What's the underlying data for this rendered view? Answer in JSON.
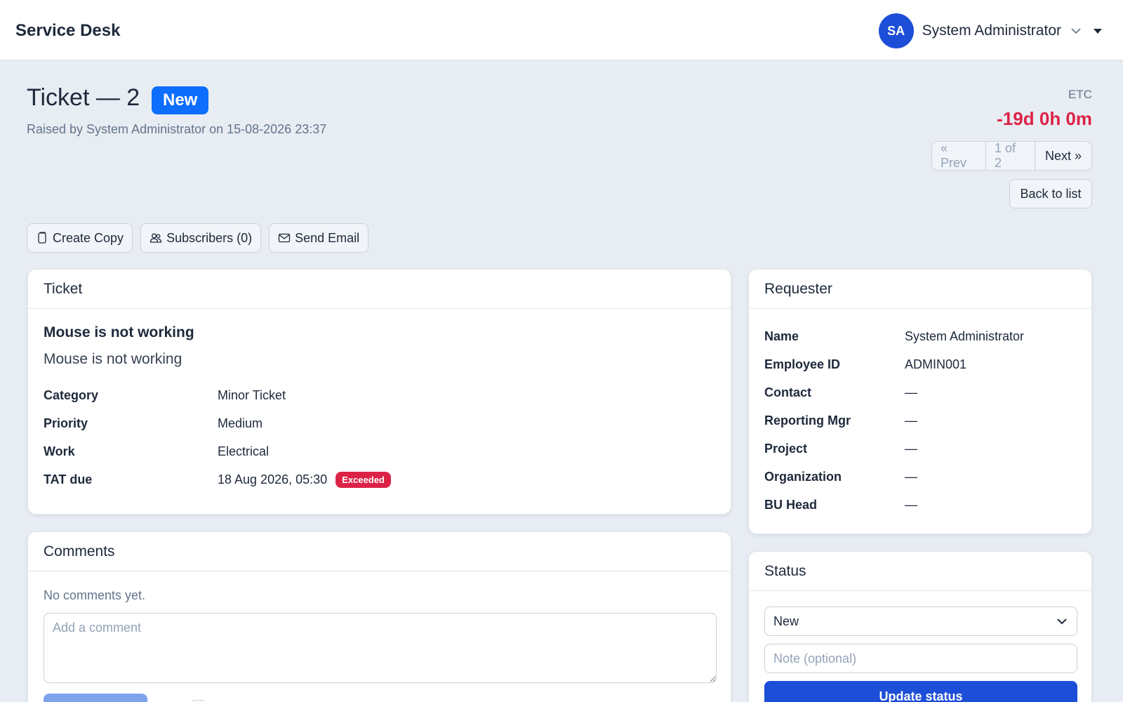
{
  "app": {
    "brand": "Service Desk"
  },
  "user": {
    "initials": "SA",
    "name": "System Administrator"
  },
  "ticket_header": {
    "title": "Ticket — 2",
    "status": "New",
    "raised_by": "Raised by System Administrator on 15-08-2026 23:37",
    "etc_label": "ETC",
    "etc_value": "-19d 0h 0m"
  },
  "pager": {
    "prev": "« Prev",
    "count": "1 of 2",
    "next": "Next »"
  },
  "back_label": "Back to list",
  "actions": {
    "create_copy": "Create Copy",
    "subscribers": "Subscribers (0)",
    "send_email": "Send Email"
  },
  "ticket": {
    "header": "Ticket",
    "subject": "Mouse is not working",
    "description": "Mouse is not working",
    "fields": [
      {
        "label": "Category",
        "value": "Minor Ticket"
      },
      {
        "label": "Priority",
        "value": "Medium"
      },
      {
        "label": "Work",
        "value": "Electrical"
      },
      {
        "label": "TAT due",
        "value": "18 Aug 2026, 05:30"
      }
    ],
    "tat_badge": "Exceeded"
  },
  "comments": {
    "header": "Comments",
    "empty_text": "No comments yet.",
    "placeholder": "Add a comment"
  },
  "requester": {
    "header": "Requester",
    "fields": [
      {
        "label": "Name",
        "value": "System Administrator"
      },
      {
        "label": "Employee ID",
        "value": "ADMIN001"
      },
      {
        "label": "Contact",
        "value": "—"
      },
      {
        "label": "Reporting Mgr",
        "value": "—"
      },
      {
        "label": "Project",
        "value": "—"
      },
      {
        "label": "Organization",
        "value": "—"
      },
      {
        "label": "BU Head",
        "value": "—"
      }
    ]
  },
  "status_panel": {
    "header": "Status",
    "selected": "New",
    "note_placeholder": "Note (optional)",
    "update_label": "Update status"
  },
  "colors": {
    "accent": "#1d4ed8",
    "status_pill": "#0d6efd",
    "danger": "#dc2347",
    "background": "#e8edf3"
  }
}
